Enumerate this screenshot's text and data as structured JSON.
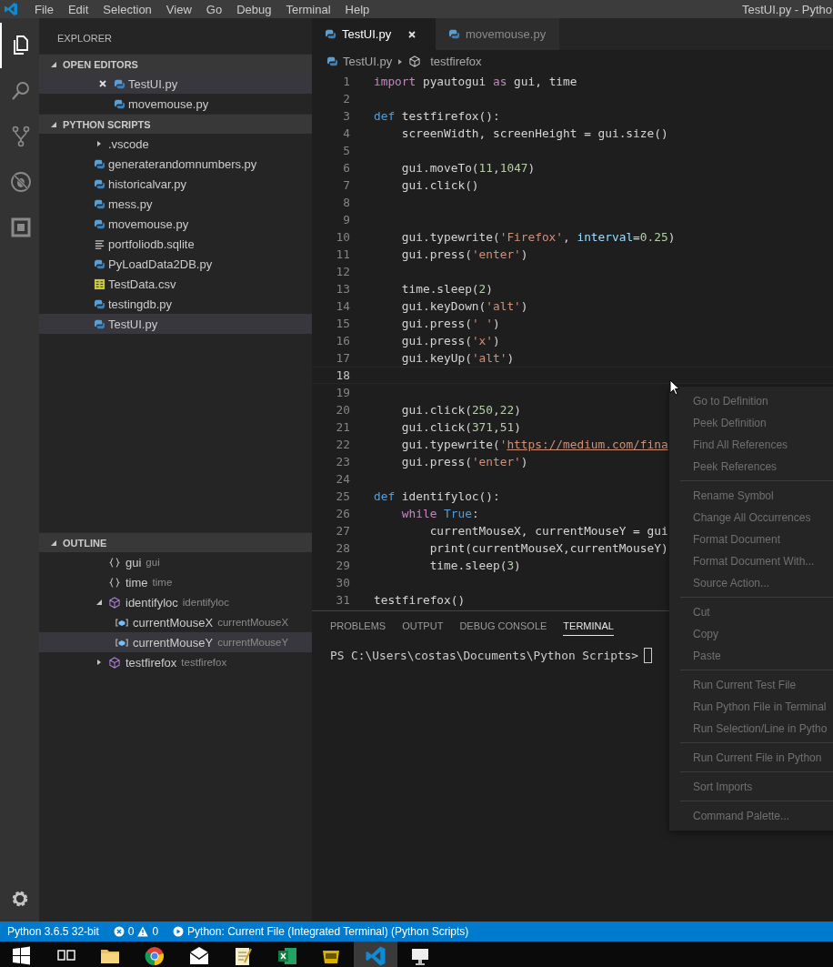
{
  "title_bar": {
    "menu": [
      "File",
      "Edit",
      "Selection",
      "View",
      "Go",
      "Debug",
      "Terminal",
      "Help"
    ],
    "title": "TestUI.py - Pytho"
  },
  "activity_bar": [
    {
      "kind": "files",
      "selected": true
    },
    {
      "kind": "search",
      "selected": false
    },
    {
      "kind": "source-control",
      "selected": false
    },
    {
      "kind": "debug",
      "selected": false
    },
    {
      "kind": "extensions",
      "selected": false
    }
  ],
  "sidebar": {
    "title": "EXPLORER",
    "open_editors": {
      "label": "OPEN EDITORS",
      "expanded": true,
      "items": [
        {
          "name": "TestUI.py",
          "kind": "python",
          "selected": true
        },
        {
          "name": "movemouse.py",
          "kind": "python",
          "selected": false
        }
      ]
    },
    "folder": {
      "label": "PYTHON SCRIPTS",
      "expanded": true,
      "items": [
        {
          "name": ".vscode",
          "kind": "folder",
          "expanded": false,
          "selected": false
        },
        {
          "name": "generaterandomnumbers.py",
          "kind": "python",
          "selected": false
        },
        {
          "name": "historicalvar.py",
          "kind": "python",
          "selected": false
        },
        {
          "name": "mess.py",
          "kind": "python",
          "selected": false
        },
        {
          "name": "movemouse.py",
          "kind": "python",
          "selected": false
        },
        {
          "name": "portfoliodb.sqlite",
          "kind": "text",
          "selected": false
        },
        {
          "name": "PyLoadData2DB.py",
          "kind": "python",
          "selected": false
        },
        {
          "name": "TestData.csv",
          "kind": "csv",
          "selected": false
        },
        {
          "name": "testingdb.py",
          "kind": "python",
          "selected": false
        },
        {
          "name": "TestUI.py",
          "kind": "python",
          "selected": true
        }
      ]
    },
    "outline": {
      "label": "OUTLINE",
      "expanded": true,
      "items": [
        {
          "name": "gui",
          "detail": "gui",
          "kind": "module",
          "selected": false
        },
        {
          "name": "time",
          "detail": "time",
          "kind": "module",
          "selected": false
        },
        {
          "name": "identifyloc",
          "detail": "identifyloc",
          "kind": "function",
          "selected": false,
          "expanded": true,
          "children": [
            {
              "name": "currentMouseX",
              "detail": "currentMouseX",
              "kind": "variable",
              "selected": false
            },
            {
              "name": "currentMouseY",
              "detail": "currentMouseY",
              "kind": "variable",
              "selected": true
            }
          ]
        },
        {
          "name": "testfirefox",
          "detail": "testfirefox",
          "kind": "function",
          "selected": false,
          "expanded": false
        }
      ]
    }
  },
  "editor": {
    "tabs": [
      {
        "label": "TestUI.py",
        "selected": true
      },
      {
        "label": "movemouse.py",
        "selected": false
      }
    ],
    "breadcrumb": [
      "TestUI.py",
      "testfirefox"
    ],
    "lines": [
      {
        "number": "1",
        "current": false,
        "tokens": [
          {
            "text": "import",
            "kind": "keyword"
          },
          {
            "text": " pyautogui ",
            "kind": "plain"
          },
          {
            "text": "as",
            "kind": "keyword"
          },
          {
            "text": " gui, time",
            "kind": "plain"
          }
        ]
      },
      {
        "number": "2",
        "current": false
      },
      {
        "number": "3",
        "current": false,
        "tokens": [
          {
            "text": "def",
            "kind": "storage"
          },
          {
            "text": " testfirefox():",
            "kind": "plain"
          }
        ]
      },
      {
        "number": "4",
        "current": false,
        "tokens": [
          {
            "text": "    screenWidth, screenHeight = gui.size()",
            "kind": "plain"
          }
        ]
      },
      {
        "number": "5",
        "current": false
      },
      {
        "number": "6",
        "current": false,
        "tokens": [
          {
            "text": "    gui.moveTo(",
            "kind": "plain"
          },
          {
            "text": "11",
            "kind": "number"
          },
          {
            "text": ",",
            "kind": "plain"
          },
          {
            "text": "1047",
            "kind": "number"
          },
          {
            "text": ")",
            "kind": "plain"
          }
        ]
      },
      {
        "number": "7",
        "current": false,
        "tokens": [
          {
            "text": "    gui.click()",
            "kind": "plain"
          }
        ]
      },
      {
        "number": "8",
        "current": false
      },
      {
        "number": "9",
        "current": false
      },
      {
        "number": "10",
        "current": false,
        "tokens": [
          {
            "text": "    gui.typewrite(",
            "kind": "plain"
          },
          {
            "text": "'Firefox'",
            "kind": "string"
          },
          {
            "text": ", ",
            "kind": "plain"
          },
          {
            "text": "interval",
            "kind": "param"
          },
          {
            "text": "=",
            "kind": "plain"
          },
          {
            "text": "0.25",
            "kind": "number"
          },
          {
            "text": ")",
            "kind": "plain"
          }
        ]
      },
      {
        "number": "11",
        "current": false,
        "tokens": [
          {
            "text": "    gui.press(",
            "kind": "plain"
          },
          {
            "text": "'enter'",
            "kind": "string"
          },
          {
            "text": ")",
            "kind": "plain"
          }
        ]
      },
      {
        "number": "12",
        "current": false
      },
      {
        "number": "13",
        "current": false,
        "tokens": [
          {
            "text": "    time.sleep(",
            "kind": "plain"
          },
          {
            "text": "2",
            "kind": "number"
          },
          {
            "text": ")",
            "kind": "plain"
          }
        ]
      },
      {
        "number": "14",
        "current": false,
        "tokens": [
          {
            "text": "    gui.keyDown(",
            "kind": "plain"
          },
          {
            "text": "'alt'",
            "kind": "string"
          },
          {
            "text": ")",
            "kind": "plain"
          }
        ]
      },
      {
        "number": "15",
        "current": false,
        "tokens": [
          {
            "text": "    gui.press(",
            "kind": "plain"
          },
          {
            "text": "' '",
            "kind": "string"
          },
          {
            "text": ")",
            "kind": "plain"
          }
        ]
      },
      {
        "number": "16",
        "current": false,
        "tokens": [
          {
            "text": "    gui.press(",
            "kind": "plain"
          },
          {
            "text": "'x'",
            "kind": "string"
          },
          {
            "text": ")",
            "kind": "plain"
          }
        ]
      },
      {
        "number": "17",
        "current": false,
        "tokens": [
          {
            "text": "    gui.keyUp(",
            "kind": "plain"
          },
          {
            "text": "'alt'",
            "kind": "string"
          },
          {
            "text": ")",
            "kind": "plain"
          }
        ]
      },
      {
        "number": "18",
        "current": true
      },
      {
        "number": "19",
        "current": false
      },
      {
        "number": "20",
        "current": false,
        "tokens": [
          {
            "text": "    gui.click(",
            "kind": "plain"
          },
          {
            "text": "250",
            "kind": "number"
          },
          {
            "text": ",",
            "kind": "plain"
          },
          {
            "text": "22",
            "kind": "number"
          },
          {
            "text": ")",
            "kind": "plain"
          }
        ]
      },
      {
        "number": "21",
        "current": false,
        "tokens": [
          {
            "text": "    gui.click(",
            "kind": "plain"
          },
          {
            "text": "371",
            "kind": "number"
          },
          {
            "text": ",",
            "kind": "plain"
          },
          {
            "text": "51",
            "kind": "number"
          },
          {
            "text": ")",
            "kind": "plain"
          }
        ]
      },
      {
        "number": "22",
        "current": false,
        "tokens": [
          {
            "text": "    gui.typewrite(",
            "kind": "plain"
          },
          {
            "text": "'",
            "kind": "string"
          },
          {
            "text": "https://medium.com/fina",
            "kind": "link"
          }
        ]
      },
      {
        "number": "23",
        "current": false,
        "tokens": [
          {
            "text": "    gui.press(",
            "kind": "plain"
          },
          {
            "text": "'enter'",
            "kind": "string"
          },
          {
            "text": ")",
            "kind": "plain"
          }
        ]
      },
      {
        "number": "24",
        "current": false
      },
      {
        "number": "25",
        "current": false,
        "tokens": [
          {
            "text": "def",
            "kind": "storage"
          },
          {
            "text": " identifyloc():",
            "kind": "plain"
          }
        ]
      },
      {
        "number": "26",
        "current": false,
        "tokens": [
          {
            "text": "    while",
            "kind": "keyword"
          },
          {
            "text": " True",
            "kind": "constant"
          },
          {
            "text": ":",
            "kind": "plain"
          }
        ]
      },
      {
        "number": "27",
        "current": false,
        "tokens": [
          {
            "text": "        currentMouseX, currentMouseY = gui",
            "kind": "plain"
          }
        ]
      },
      {
        "number": "28",
        "current": false,
        "tokens": [
          {
            "text": "        print(currentMouseX,currentMouseY)",
            "kind": "plain"
          }
        ]
      },
      {
        "number": "29",
        "current": false,
        "tokens": [
          {
            "text": "        time.sleep(",
            "kind": "plain"
          },
          {
            "text": "3",
            "kind": "number"
          },
          {
            "text": ")",
            "kind": "plain"
          }
        ]
      },
      {
        "number": "30",
        "current": false
      },
      {
        "number": "31",
        "current": false,
        "tokens": [
          {
            "text": "testfirefox()",
            "kind": "plain"
          }
        ]
      }
    ]
  },
  "panel": {
    "tabs": [
      {
        "label": "PROBLEMS",
        "selected": false
      },
      {
        "label": "OUTPUT",
        "selected": false
      },
      {
        "label": "DEBUG CONSOLE",
        "selected": false
      },
      {
        "label": "TERMINAL",
        "selected": true
      }
    ],
    "terminal_prompt": "PS C:\\Users\\costas\\Documents\\Python Scripts>"
  },
  "context_menu": [
    [
      "Go to Definition",
      "Peek Definition",
      "Find All References",
      "Peek References"
    ],
    [
      "Rename Symbol",
      "Change All Occurrences",
      "Format Document",
      "Format Document With...",
      "Source Action..."
    ],
    [
      "Cut",
      "Copy",
      "Paste"
    ],
    [
      "Run Current Test File",
      "Run Python File in Terminal",
      "Run Selection/Line in Pytho"
    ],
    [
      "Run Current File in Python"
    ],
    [
      "Sort Imports"
    ],
    [
      "Command Palette..."
    ]
  ],
  "status_bar": {
    "interpreter": "Python 3.6.5 32-bit",
    "errors": "0",
    "warnings": "0",
    "launch": "Python: Current File (Integrated Terminal) (Python Scripts)"
  },
  "taskbar": [
    {
      "kind": "start",
      "active": false
    },
    {
      "kind": "task-view",
      "active": false
    },
    {
      "kind": "folder",
      "active": false
    },
    {
      "kind": "browser",
      "active": false
    },
    {
      "kind": "mail",
      "active": false
    },
    {
      "kind": "notepad",
      "active": false
    },
    {
      "kind": "spreadsheet",
      "active": false
    },
    {
      "kind": "pdf",
      "active": false
    },
    {
      "kind": "editor",
      "active": true
    },
    {
      "kind": "monitor",
      "active": false
    }
  ]
}
